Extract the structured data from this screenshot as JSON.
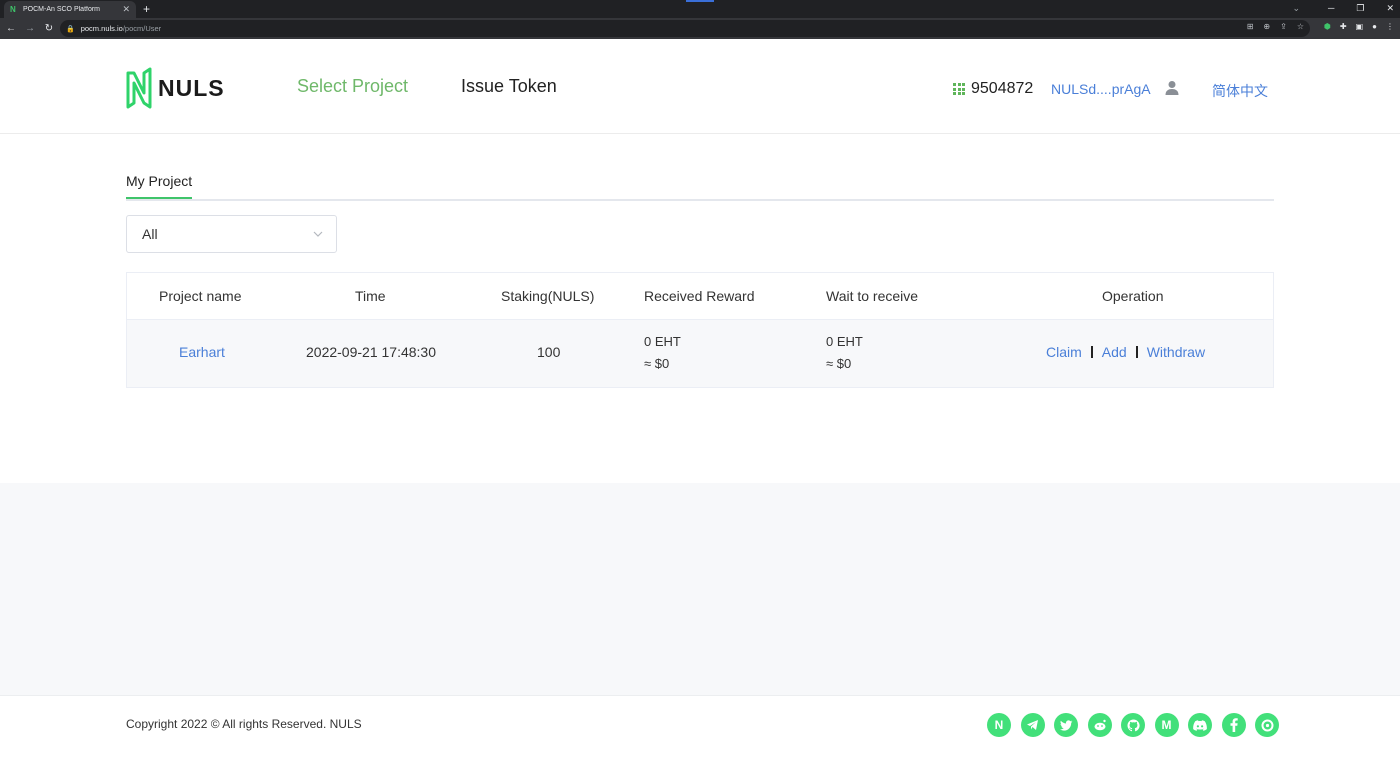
{
  "browser": {
    "tab_title": "POCM-An SCO Platform",
    "tab_close": "✕",
    "new_tab": "+",
    "url_host": "pocm.nuls.io",
    "url_path": "/pocm/User",
    "window_controls": [
      "─",
      "❐",
      "✕"
    ]
  },
  "header": {
    "logo_text": "NULS",
    "nav": {
      "select_project": "Select Project",
      "issue_token": "Issue Token"
    },
    "balance": "9504872",
    "address": "NULSd....prAgA",
    "language": "简体中文",
    "colors": {
      "nav_active": "#6fb86a",
      "link": "#4a7fd8",
      "brand_green": "#3fc46a"
    }
  },
  "main": {
    "tab_label": "My Project",
    "filter": {
      "value": "All"
    },
    "table": {
      "headers": [
        "Project name",
        "Time",
        "Staking(NULS)",
        "Received Reward",
        "Wait to receive",
        "Operation"
      ],
      "rows": [
        {
          "project_name": "Earhart",
          "time": "2022-09-21 17:48:30",
          "staking": "100",
          "received_amount": "0 EHT",
          "received_usd": "≈ $0",
          "wait_amount": "0 EHT",
          "wait_usd": "≈ $0",
          "ops": {
            "claim": "Claim",
            "add": "Add",
            "withdraw": "Withdraw"
          }
        }
      ]
    }
  },
  "footer": {
    "copyright": "Copyright 2022 © All rights Reserved. NULS",
    "socials": [
      "nuls-icon",
      "telegram-icon",
      "twitter-icon",
      "reddit-icon",
      "github-icon",
      "medium-icon",
      "discord-icon",
      "facebook-icon",
      "gitter-icon"
    ],
    "social_color": "#42e07a"
  }
}
